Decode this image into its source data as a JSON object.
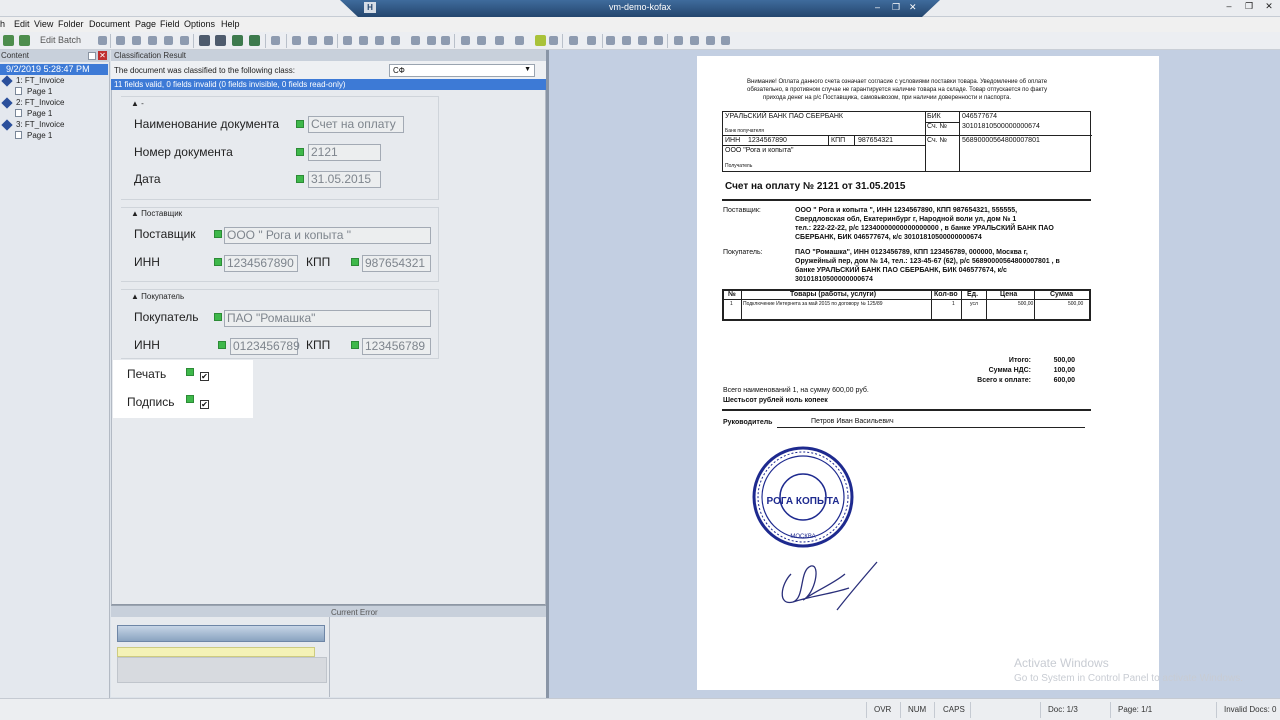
{
  "window": {
    "title": "vm-demo-kofax",
    "controls": {
      "minimize": "–",
      "restore": "❐",
      "close": "✕"
    }
  },
  "menu": [
    "h",
    "Edit",
    "View",
    "Folder",
    "Document",
    "Page",
    "Field",
    "Options",
    "Help"
  ],
  "toolbar": {
    "edit_batch": "Edit Batch"
  },
  "left_pane": {
    "header": "Content",
    "batch_label": "9/2/2019 5:28:47 PM",
    "tree": [
      {
        "doc": "1: FT_Invoice",
        "page": "Page 1"
      },
      {
        "doc": "2: FT_Invoice",
        "page": "Page 1"
      },
      {
        "doc": "3: FT_Invoice",
        "page": "Page 1"
      }
    ]
  },
  "classification": {
    "header": "Classification Result",
    "label": "The document was classified to the following class:",
    "class_value": "СФ",
    "validation_text": "11 fields valid, 0 fields invalid (0 fields invisible, 0 fields read-only)"
  },
  "form": {
    "group1_title": "-",
    "doc_name_label": "Наименование документа",
    "doc_name_value": "Счет на оплату",
    "doc_number_label": "Номер документа",
    "doc_number_value": "2121",
    "date_label": "Дата",
    "date_value": "31.05.2015",
    "supplier_group": "Поставщик",
    "supplier_label": "Поставщик",
    "supplier_value": "ООО \" Рога и копыта \"",
    "supplier_inn_label": "ИНН",
    "supplier_inn_value": "1234567890",
    "supplier_kpp_label": "КПП",
    "supplier_kpp_value": "987654321",
    "buyer_group": "Покупатель",
    "buyer_label": "Покупатель",
    "buyer_value": "ПАО \"Ромашка\"",
    "buyer_inn_label": "ИНН",
    "buyer_inn_value": "0123456789",
    "buyer_kpp_label": "КПП",
    "buyer_kpp_value": "123456789",
    "stamp_label": "Печать",
    "signature_label": "Подпись",
    "check_mark": "✔"
  },
  "current_error": {
    "header": "Current Error"
  },
  "document": {
    "notice": [
      "Внимание! Оплата данного счета означает согласие с условиями поставки товара. Уведомление об оплате",
      "обязательно, в противном случае не гарантируется наличие товара на складе. Товар отпускается по факту",
      "прихода денег на р/с Поставщика, самовывозом, при наличии доверенности и паспорта."
    ],
    "bank_name": "УРАЛЬСКИЙ БАНК ПАО СБЕРБАНК",
    "bank_receiver_label": "Банк получателя",
    "bik_label": "БИК",
    "bik_value": "046577674",
    "corr_label": "Сч. №",
    "corr_value": "30101810500000000674",
    "inn_label": "ИНН",
    "inn_value": "1234567890",
    "kpp_label": "КПП",
    "kpp_value": "987654321",
    "account_label": "Сч. №",
    "account_value": "56890000564800007801",
    "receiver_name": "ООО   \"Рога и копыта\"",
    "receiver_label": "Получатель",
    "invoice_title": "Счет на оплату № 2121  от 31.05.2015",
    "supplier_label": "Поставщик:",
    "supplier_lines": [
      "ООО \" Рога и копыта       \", ИНН 1234567890, КПП 987654321, 555555,",
      "Свердловская обл, Екатеринбург г, Народной воли ул, дом № 1",
      "тел.: 222-22-22, р/с 12340000000000000000 , в банке УРАЛЬСКИЙ БАНК ПАО",
      "СБЕРБАНК, БИК 046577674, к/с 30101810500000000674"
    ],
    "buyer_label": "Покупатель:",
    "buyer_lines": [
      "ПАО \"Ромашка\", ИНН 0123456789, КПП 123456789, 000000, Москва г,",
      "Оружейный пер, дом № 14, тел.: 123-45-67 (62), р/с 56890000564800007801 , в",
      "банке УРАЛЬСКИЙ БАНК ПАО СБЕРБАНК, БИК 046577674, к/с",
      "30101810500000000674"
    ],
    "table_headers": [
      "№",
      "Товары (работы, услуги)",
      "Кол-во",
      "Ед.",
      "Цена",
      "Сумма"
    ],
    "table_row": [
      "1",
      "Подключение Интернета за май 2015 по договору № 125/89",
      "1",
      "усл",
      "500,00",
      "500,00"
    ],
    "total_label": "Итого:",
    "total_value": "500,00",
    "vat_label": "Сумма НДС:",
    "vat_value": "100,00",
    "due_label": "Всего к оплате:",
    "due_value": "600,00",
    "items_summary": "Всего наименований 1, на сумму  600,00 руб.",
    "amount_words": "Шестьсот рублей ноль копеек",
    "director_label": "Руководитель",
    "director_name": "Петров Иван Васильевич",
    "stamp_center": "РОГА КОПЫТА",
    "stamp_bottom": "МОСКВА"
  },
  "watermark": {
    "line1": "Activate Windows",
    "line2": "Go to System in Control Panel to activate Windows."
  },
  "status_bar": {
    "ovr": "OVR",
    "num": "NUM",
    "caps": "CAPS",
    "doc": "Doc: 1/3",
    "page": "Page: 1/1",
    "invalid": "Invalid Docs: 0"
  }
}
